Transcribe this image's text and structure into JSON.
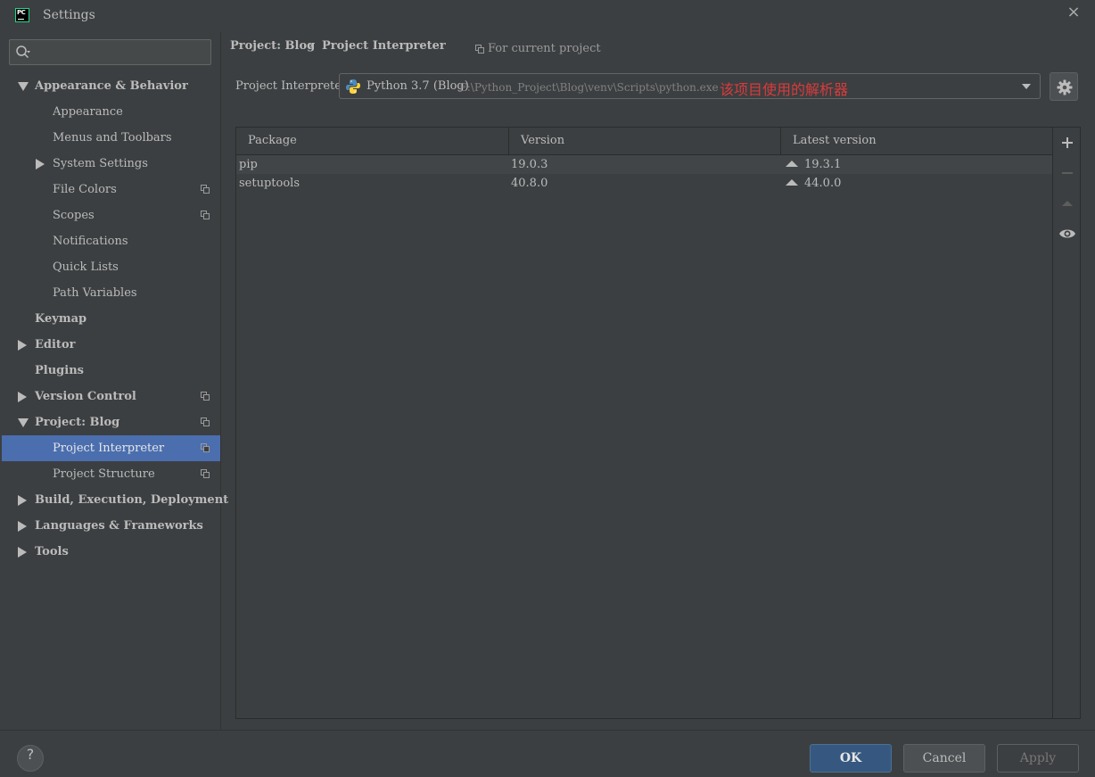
{
  "window": {
    "title": "Settings",
    "close_glyph": "×",
    "logo_text": "PC"
  },
  "sidebar": {
    "search": {
      "placeholder": ""
    },
    "items": [
      {
        "label": "Appearance & Behavior",
        "level": 0,
        "expander": "expanded"
      },
      {
        "label": "Appearance",
        "level": 1
      },
      {
        "label": "Menus and Toolbars",
        "level": 1
      },
      {
        "label": "System Settings",
        "level": 1,
        "expander": "collapsed"
      },
      {
        "label": "File Colors",
        "level": 1,
        "project_icon": true
      },
      {
        "label": "Scopes",
        "level": 1,
        "project_icon": true
      },
      {
        "label": "Notifications",
        "level": 1
      },
      {
        "label": "Quick Lists",
        "level": 1
      },
      {
        "label": "Path Variables",
        "level": 1
      },
      {
        "label": "Keymap",
        "level": 0
      },
      {
        "label": "Editor",
        "level": 0,
        "expander": "collapsed"
      },
      {
        "label": "Plugins",
        "level": 0
      },
      {
        "label": "Version Control",
        "level": 0,
        "expander": "collapsed",
        "project_icon": true
      },
      {
        "label": "Project: Blog",
        "level": 0,
        "expander": "expanded",
        "project_icon": true
      },
      {
        "label": "Project Interpreter",
        "level": 1,
        "selected": true,
        "project_icon": true
      },
      {
        "label": "Project Structure",
        "level": 1,
        "project_icon": true
      },
      {
        "label": "Build, Execution, Deployment",
        "level": 0,
        "expander": "collapsed"
      },
      {
        "label": "Languages & Frameworks",
        "level": 0,
        "expander": "collapsed"
      },
      {
        "label": "Tools",
        "level": 0,
        "expander": "collapsed"
      }
    ]
  },
  "main": {
    "breadcrumb": {
      "parent": "Project: Blog",
      "separator": "›",
      "current": "Project Interpreter"
    },
    "scope_label": "For current project",
    "interpreter": {
      "label": "Project Interpreter:",
      "name": "Python 3.7 (Blog)",
      "path": "E:\\Python_Project\\Blog\\venv\\Scripts\\python.exe",
      "note": "该项目使用的解析器"
    },
    "table": {
      "columns": [
        "Package",
        "Version",
        "Latest version"
      ],
      "rows": [
        {
          "package": "pip",
          "version": "19.0.3",
          "latest": "19.3.1"
        },
        {
          "package": "setuptools",
          "version": "40.8.0",
          "latest": "44.0.0"
        }
      ]
    }
  },
  "footer": {
    "help": "?",
    "ok": "OK",
    "cancel": "Cancel",
    "apply": "Apply"
  },
  "colors": {
    "background": "#3c3f41",
    "selection": "#4b6eaf",
    "note_red": "#d83b3b",
    "ok_button": "#365880"
  }
}
